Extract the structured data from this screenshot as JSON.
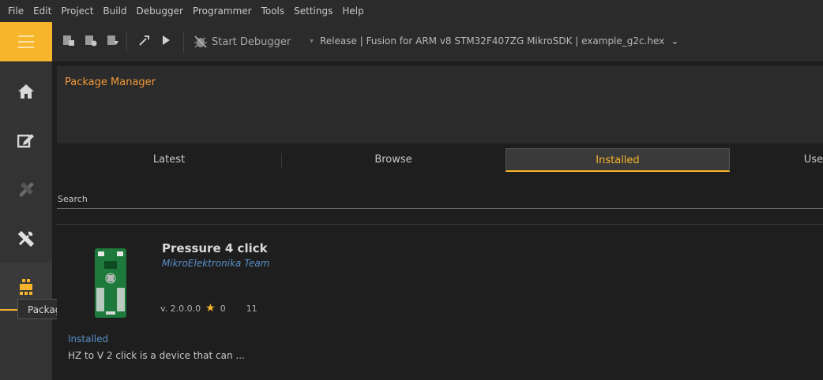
{
  "menubar": {
    "items": [
      "File",
      "Edit",
      "Project",
      "Build",
      "Debugger",
      "Programmer",
      "Tools",
      "Settings",
      "Help"
    ]
  },
  "toolbar": {
    "start_debugger_label": "Start Debugger",
    "config_label": "Release | Fusion for ARM v8 STM32F407ZG MikroSDK | example_g2c.hex"
  },
  "package_manager": {
    "title": "Package Manager",
    "tabs": [
      {
        "label": "Latest",
        "active": false
      },
      {
        "label": "Browse",
        "active": false
      },
      {
        "label": "Installed",
        "active": true
      },
      {
        "label": "Use",
        "active": false
      }
    ],
    "search_placeholder": "Search",
    "package": {
      "name": "Pressure 4 click",
      "author": "MikroElektronika Team",
      "version": "v. 2.0.0.0",
      "rating": "0",
      "downloads": "11",
      "status": "Installed",
      "description": "HZ to V 2 click is a device that can ..."
    }
  },
  "sidebar": {
    "items": [
      "home",
      "edit",
      "design",
      "tools",
      "packages"
    ],
    "tooltip": "Packages"
  },
  "colors": {
    "accent": "#f7b52c",
    "link": "#5a8fc9",
    "title_orange": "#f29a3a"
  }
}
